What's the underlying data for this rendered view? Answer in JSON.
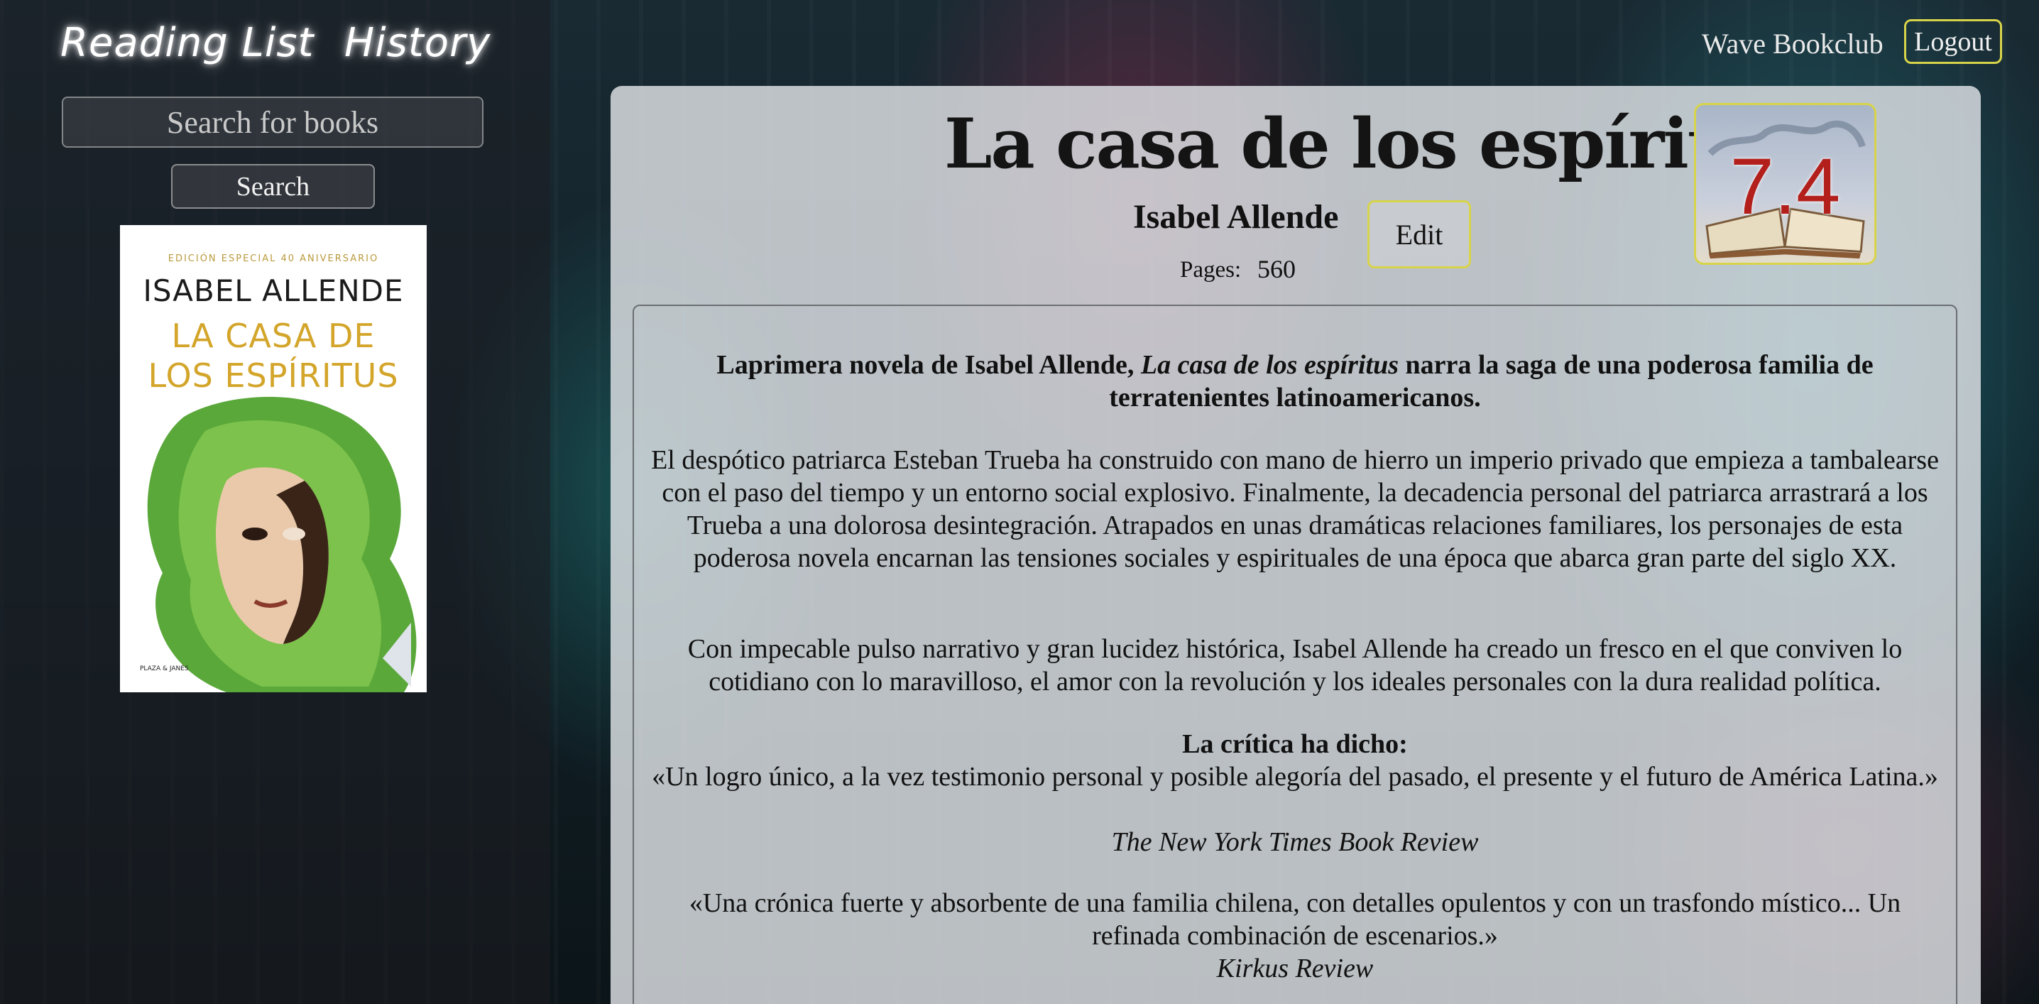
{
  "nav": {
    "reading_list": "Reading List",
    "history": "History"
  },
  "search": {
    "placeholder": "Search for books",
    "button_label": "Search"
  },
  "header": {
    "club_name": "Wave Bookclub",
    "logout_label": "Logout"
  },
  "book": {
    "title": "La casa de los espíritus",
    "author": "Isabel Allende",
    "edit_label": "Edit",
    "pages_label": "Pages:",
    "pages_value": "560",
    "rating": "7.4",
    "cover": {
      "edition_text": "EDICIÓN ESPECIAL 40 ANIVERSARIO",
      "author_text": "ISABEL ALLENDE",
      "title_line1": "LA CASA DE",
      "title_line2": "LOS ESPÍRITUS",
      "publisher_text": "PLAZA & JANÉS"
    },
    "description": {
      "lead_prefix": "Laprimera novela de Isabel Allende, ",
      "lead_italic": "La casa de los espíritus",
      "lead_suffix": " narra la saga de una poderosa familia de terratenientes latinoamericanos.",
      "paragraph1": "El despótico patriarca Esteban Trueba ha construido con mano de hierro un imperio privado que empieza a tambalearse con el paso del tiempo y un entorno social explosivo. Finalmente, la decadencia personal del patriarca arrastrará a los Trueba a una dolorosa desintegración. Atrapados en unas dramáticas relaciones familiares, los personajes de esta poderosa novela encarnan las tensiones sociales y espirituales de una época que abarca gran parte del siglo XX.",
      "paragraph2": "Con impecable pulso narrativo y gran lucidez histórica, Isabel Allende ha creado un fresco en el que conviven lo cotidiano con lo maravilloso, el amor con la revolución y los ideales personales con la dura realidad política.",
      "critics_heading": "La crítica ha dicho:",
      "quote1": "«Un logro único, a la vez testimonio personal y posible alegoría del pasado, el presente y el futuro de América Latina.»",
      "source1": "The New York Times Book Review",
      "quote2": "«Una crónica fuerte y absorbente de una familia chilena, con detalles opulentos y con un trasfondo místico... Un refinada combinación de escenarios.»",
      "source2": "Kirkus Review"
    }
  },
  "colors": {
    "accent_border": "#d8d44a",
    "rating_text": "#b3201c",
    "panel_bg": "#e1e4e8"
  }
}
